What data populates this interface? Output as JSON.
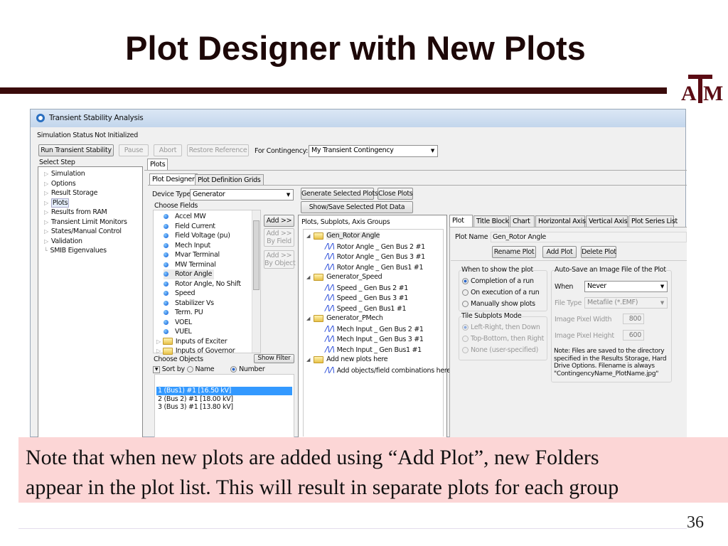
{
  "slide": {
    "title": "Plot Designer with New Plots",
    "note_line1": "Note that when new plots are added using “Add Plot”, new Folders",
    "note_line2": "appear in the plot list.  This will result in separate plots for each group",
    "page_number": "36",
    "logo": "ATM"
  },
  "colors": {
    "title_bar": "#3a0b0b",
    "note_bg": "#fcd6d6",
    "logo": "#5b0c14",
    "selection": "#3399ff"
  },
  "app": {
    "window_title": "Transient Stability Analysis",
    "status_label": "Simulation Status",
    "status_value": "Not Initialized",
    "buttons": {
      "run": "Run Transient Stability",
      "pause": "Pause",
      "abort": "Abort",
      "restore": "Restore Reference"
    },
    "contingency_label": "For Contingency:",
    "contingency_value": "My Transient Contingency",
    "select_step_label": "Select Step",
    "steps": [
      "Simulation",
      "Options",
      "Result Storage",
      "Plots",
      "Results from RAM",
      "Transient Limit Monitors",
      "States/Manual Control",
      "Validation",
      "SMIB Eigenvalues"
    ],
    "plots_tab": "Plots",
    "subtabs": [
      "Plot Designer",
      "Plot Definition Grids"
    ],
    "device_type_label": "Device Type",
    "device_type_value": "Generator",
    "choose_fields_label": "Choose Fields",
    "fields": [
      "Accel MW",
      "Field Current",
      "Field Voltage (pu)",
      "Mech Input",
      "Mvar Terminal",
      "MW Terminal",
      "Rotor Angle",
      "Rotor Angle, No Shift",
      "Speed",
      "Stabilizer Vs",
      "Term. PU",
      "VOEL",
      "VUEL"
    ],
    "field_folders": [
      "Inputs of Exciter",
      "Inputs of Governor"
    ],
    "add_buttons": {
      "add": "Add >>",
      "by_field_1": "Add >>",
      "by_field_2": "By Field",
      "by_object_1": "Add >>",
      "by_object_2": "By Object"
    },
    "choose_objects_label": "Choose Objects",
    "show_filter": "Show Filter",
    "sort_by": "Sort by",
    "sort_name": "Name",
    "sort_number": "Number",
    "objects": [
      "1 (Bus1) #1  [16.50 kV]",
      "2 (Bus 2) #1  [18.00 kV]",
      "3 (Bus 3) #1  [13.80 kV]"
    ],
    "generate": "Generate Selected Plots",
    "close_plots": "Close Plots",
    "show_save": "Show/Save Selected Plot Data",
    "tree_header": "Plots, Subplots, Axis Groups",
    "tree": [
      {
        "folder": "Gen_Rotor Angle",
        "items": [
          "Rotor Angle _ Gen Bus 2 #1",
          "Rotor Angle _ Gen Bus 3 #1",
          "Rotor Angle _ Gen Bus1 #1"
        ]
      },
      {
        "folder": "Generator_Speed",
        "items": [
          "Speed _ Gen Bus 2 #1",
          "Speed _ Gen Bus 3 #1",
          "Speed _ Gen Bus1 #1"
        ]
      },
      {
        "folder": "Generator_PMech",
        "items": [
          "Mech Input _ Gen Bus 2 #1",
          "Mech Input _ Gen Bus 3 #1",
          "Mech Input _ Gen Bus1 #1"
        ]
      },
      {
        "folder": "Add new plots here",
        "items": [
          "Add objects/field combinations here"
        ]
      }
    ],
    "right_tabs": [
      "Plot",
      "Title Block",
      "Chart",
      "Horizontal Axis",
      "Vertical Axis",
      "Plot Series List"
    ],
    "plot_name_label": "Plot Name",
    "plot_name_value": "Gen_Rotor Angle",
    "rename_plot": "Rename Plot",
    "add_plot": "Add Plot",
    "delete_plot": "Delete Plot",
    "when_show_label": "When to show the plot",
    "when_show_options": [
      "Completion of a run",
      "On execution of a run",
      "Manually show plots"
    ],
    "tile_label": "Tile Subplots Mode",
    "tile_options": [
      "Left-Right, then Down",
      "Top-Bottom, then Right",
      "None (user-specified)"
    ],
    "autosave_label": "Auto-Save an Image File of the Plot",
    "when_label": "When",
    "when_value": "Never",
    "file_type_label": "File Type",
    "file_type_value": "Metafile (*.EMF)",
    "width_label": "Image Pixel Width",
    "width_value": "800",
    "height_label": "Image Pixel Height",
    "height_value": "600",
    "note": [
      "Note: Files are saved to the directory",
      "specified in the Results Storage, Hard",
      "Drive Options.  Filename is always",
      "\"ContingencyName_PlotName.jpg\""
    ]
  }
}
